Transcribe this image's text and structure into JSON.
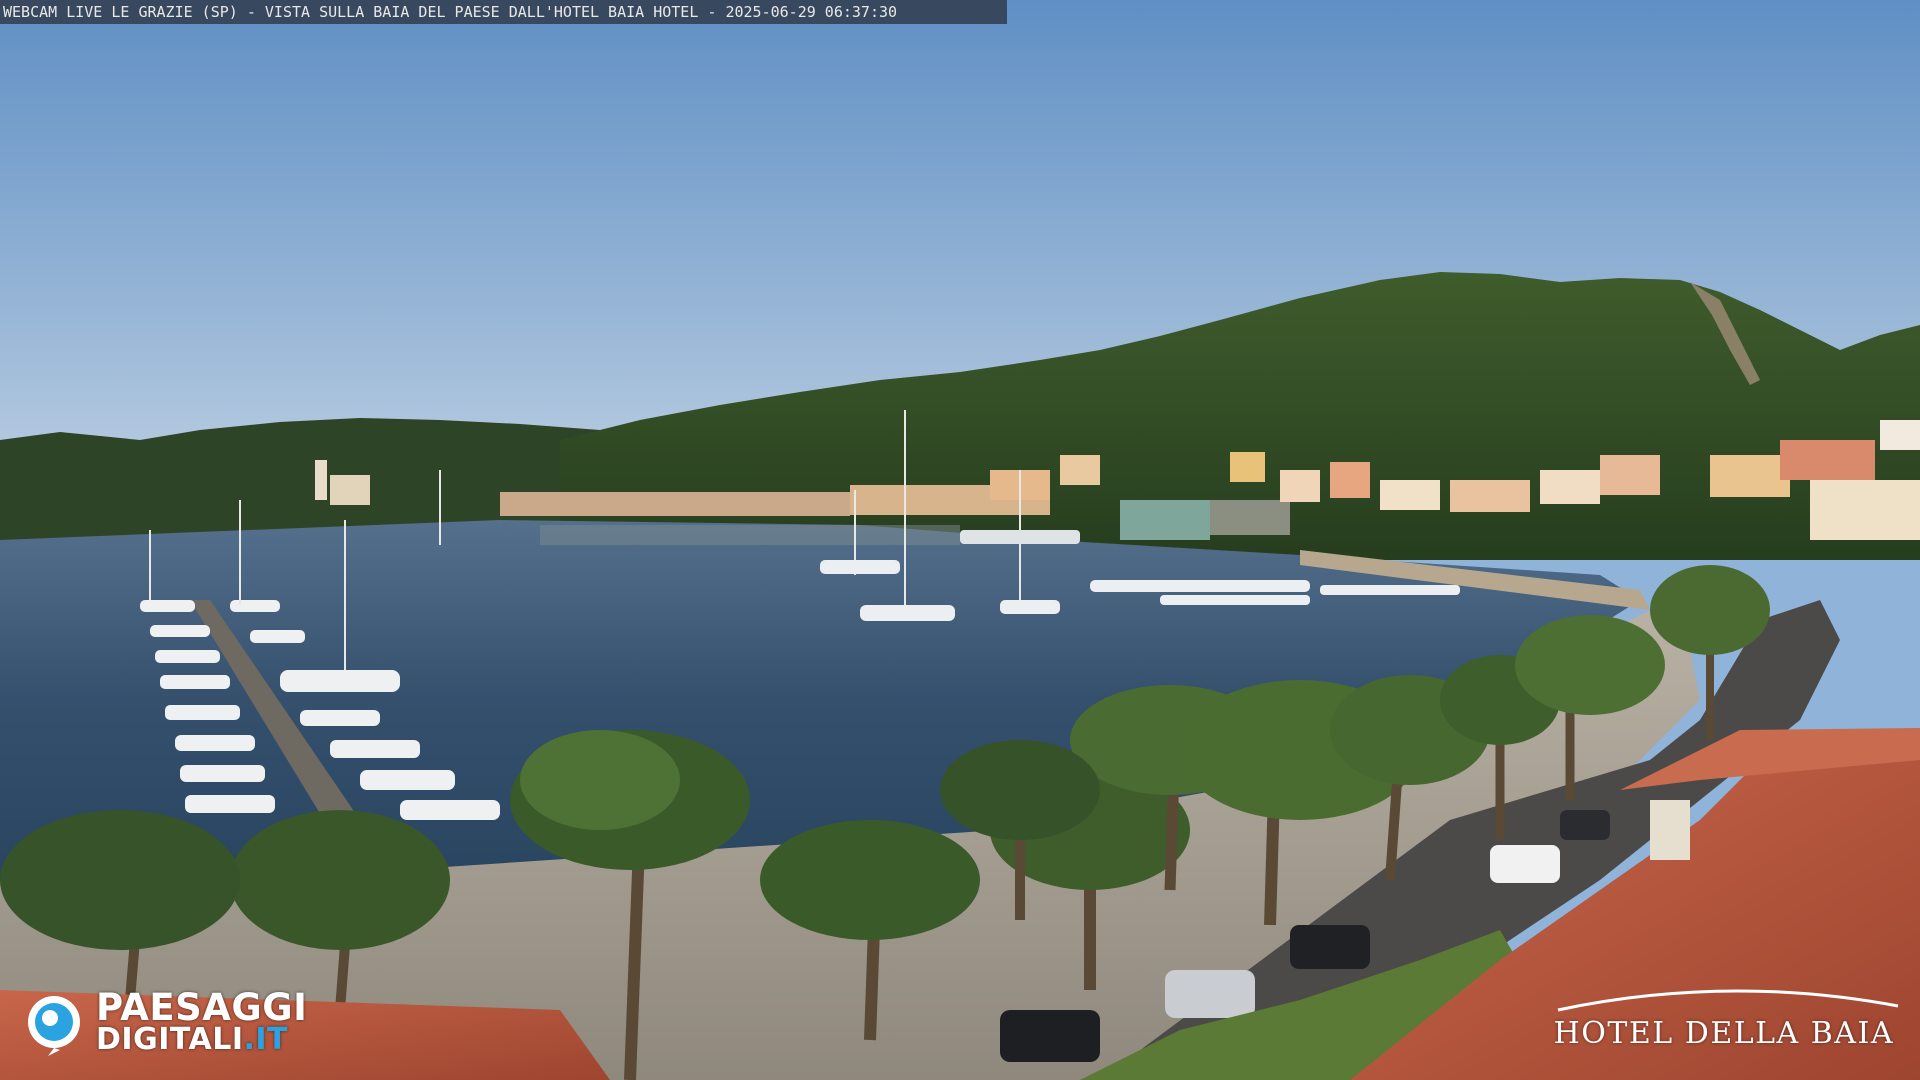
{
  "overlay": {
    "caption": "WEBCAM LIVE LE GRAZIE (SP) - VISTA SULLA BAIA DEL PAESE DALL'HOTEL BAIA HOTEL - 2025-06-29 06:37:30"
  },
  "watermarks": {
    "left_logo_line1": "PAESAGGI",
    "left_logo_line2": "DIGITALI",
    "left_logo_tld": ".IT",
    "right_logo": "HOTEL DELLA BAIA"
  },
  "colors": {
    "sky_top": "#5f8fc4",
    "sky_horizon": "#c9d8e6",
    "water": "#2e4a66",
    "hills": "#2f4a25",
    "roof": "#b5553b",
    "brand_blue": "#2aa3e0"
  }
}
